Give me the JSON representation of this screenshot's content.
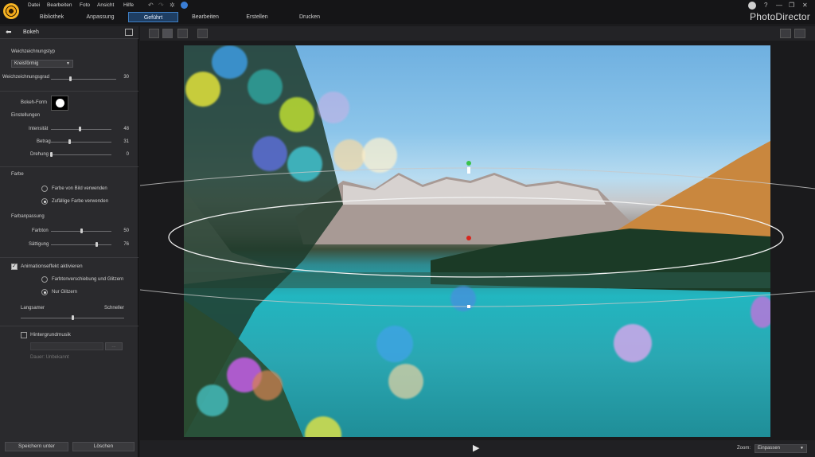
{
  "menu": [
    "Datei",
    "Bearbeiten",
    "Foto",
    "Ansicht",
    "Hilfe"
  ],
  "tabs": [
    "Bibliothek",
    "Anpassung",
    "Geführt",
    "Bearbeiten",
    "Erstellen",
    "Drucken"
  ],
  "active_tab": "Geführt",
  "brand": "PhotoDirector",
  "window_controls": [
    "?",
    "—",
    "❐",
    "✕"
  ],
  "panel": {
    "title": "Bokeh",
    "blur_type_label": "Weichzeichnungstyp",
    "blur_type_value": "Kreisförmig",
    "blur_degree_label": "Weichzeichnungsgrad",
    "blur_degree_value": "30",
    "blur_degree_level": 0.3,
    "bokeh_shape_label": "Bokeh-Form",
    "settings_label": "Einstellungen",
    "intensity_label": "Intensität",
    "intensity_value": "48",
    "intensity_level": 0.48,
    "amount_label": "Betrag",
    "amount_value": "31",
    "amount_level": 0.31,
    "rotation_label": "Drehung",
    "rotation_value": "0",
    "rotation_level": 0.0,
    "color_label": "Farbe",
    "color_from_image": "Farbe von Bild verwenden",
    "color_random": "Zufällige Farbe verwenden",
    "color_adjust_label": "Farbanpassung",
    "hue_label": "Farbton",
    "hue_value": "50",
    "hue_level": 0.5,
    "saturation_label": "Sättigung",
    "saturation_value": "76",
    "saturation_level": 0.76,
    "animation_label": "Animationseffekt aktivieren",
    "anim_option1": "Farbtonverschiebung und Glitzern",
    "anim_option2": "Nur Glitzern",
    "slower_label": "Langsamer",
    "faster_label": "Schneller",
    "speed_level": 0.5,
    "bg_music_label": "Hintergrundmusik",
    "browse_label": "...",
    "duration_label": "Dauer: Unbekannt",
    "save_as_label": "Speichern unter",
    "delete_label": "Löschen"
  },
  "bottom": {
    "zoom_label": "Zoom:",
    "zoom_value": "Einpassen"
  },
  "icons": [
    "back-arrow-icon",
    "export-icon",
    "undo-icon",
    "redo-icon",
    "settings-icon",
    "grid-view-icon",
    "compare-icon",
    "zoom-icon",
    "hand-icon",
    "play-icon"
  ]
}
